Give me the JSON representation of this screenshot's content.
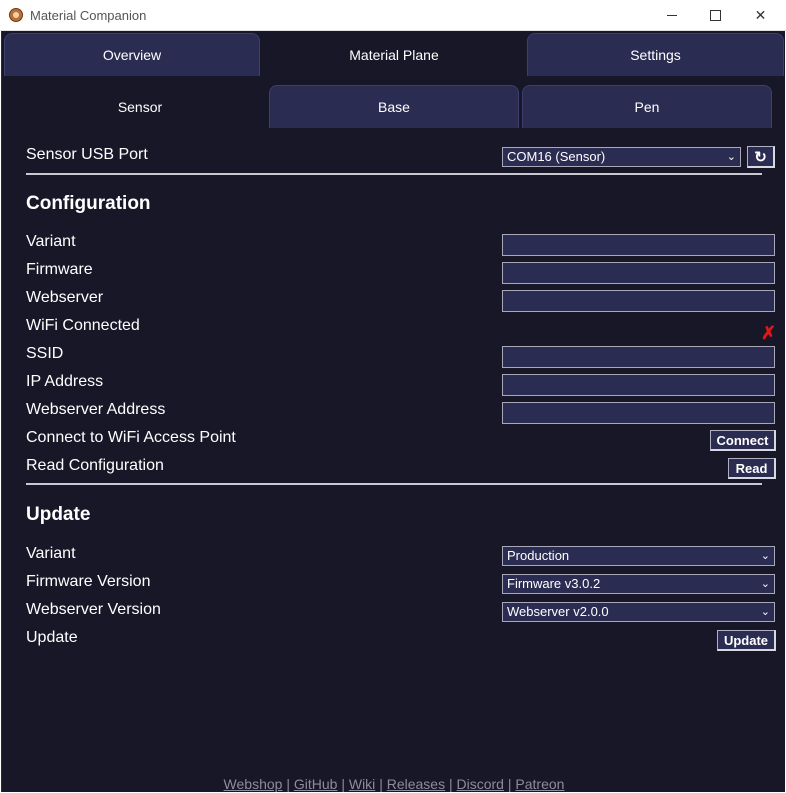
{
  "window": {
    "title": "Material Companion",
    "minimize_glyph": "",
    "maximize_glyph": "",
    "close_glyph": "✕"
  },
  "tabs_top": [
    {
      "label": "Overview",
      "active": false
    },
    {
      "label": "Material Plane",
      "active": true
    },
    {
      "label": "Settings",
      "active": false
    }
  ],
  "tabs_sub": [
    {
      "label": "Sensor",
      "active": true
    },
    {
      "label": "Base",
      "active": false
    },
    {
      "label": "Pen",
      "active": false
    }
  ],
  "usb": {
    "label": "Sensor USB Port",
    "selected": "COM16 (Sensor)",
    "refresh_icon": "↻"
  },
  "configuration": {
    "title": "Configuration",
    "variant_label": "Variant",
    "firmware_label": "Firmware",
    "webserver_label": "Webserver",
    "wifi_connected_label": "WiFi Connected",
    "wifi_connected_value": "✗",
    "ssid_label": "SSID",
    "ip_label": "IP Address",
    "webserver_address_label": "Webserver Address",
    "connect_label": "Connect to WiFi Access Point",
    "connect_button": "Connect",
    "read_label": "Read Configuration",
    "read_button": "Read"
  },
  "update": {
    "title": "Update",
    "variant_label": "Variant",
    "variant_selected": "Production",
    "firmware_label": "Firmware Version",
    "firmware_selected": "Firmware v3.0.2",
    "webserver_label": "Webserver Version",
    "webserver_selected": "Webserver v2.0.0",
    "update_label": "Update",
    "update_button": "Update"
  },
  "footer": {
    "links": [
      "Webshop",
      "GitHub",
      "Wiki",
      "Releases",
      "Discord",
      "Patreon"
    ],
    "separator": "|"
  },
  "colors": {
    "background": "#171728",
    "tab_inactive": "#2b2c52",
    "error": "#e01818"
  }
}
